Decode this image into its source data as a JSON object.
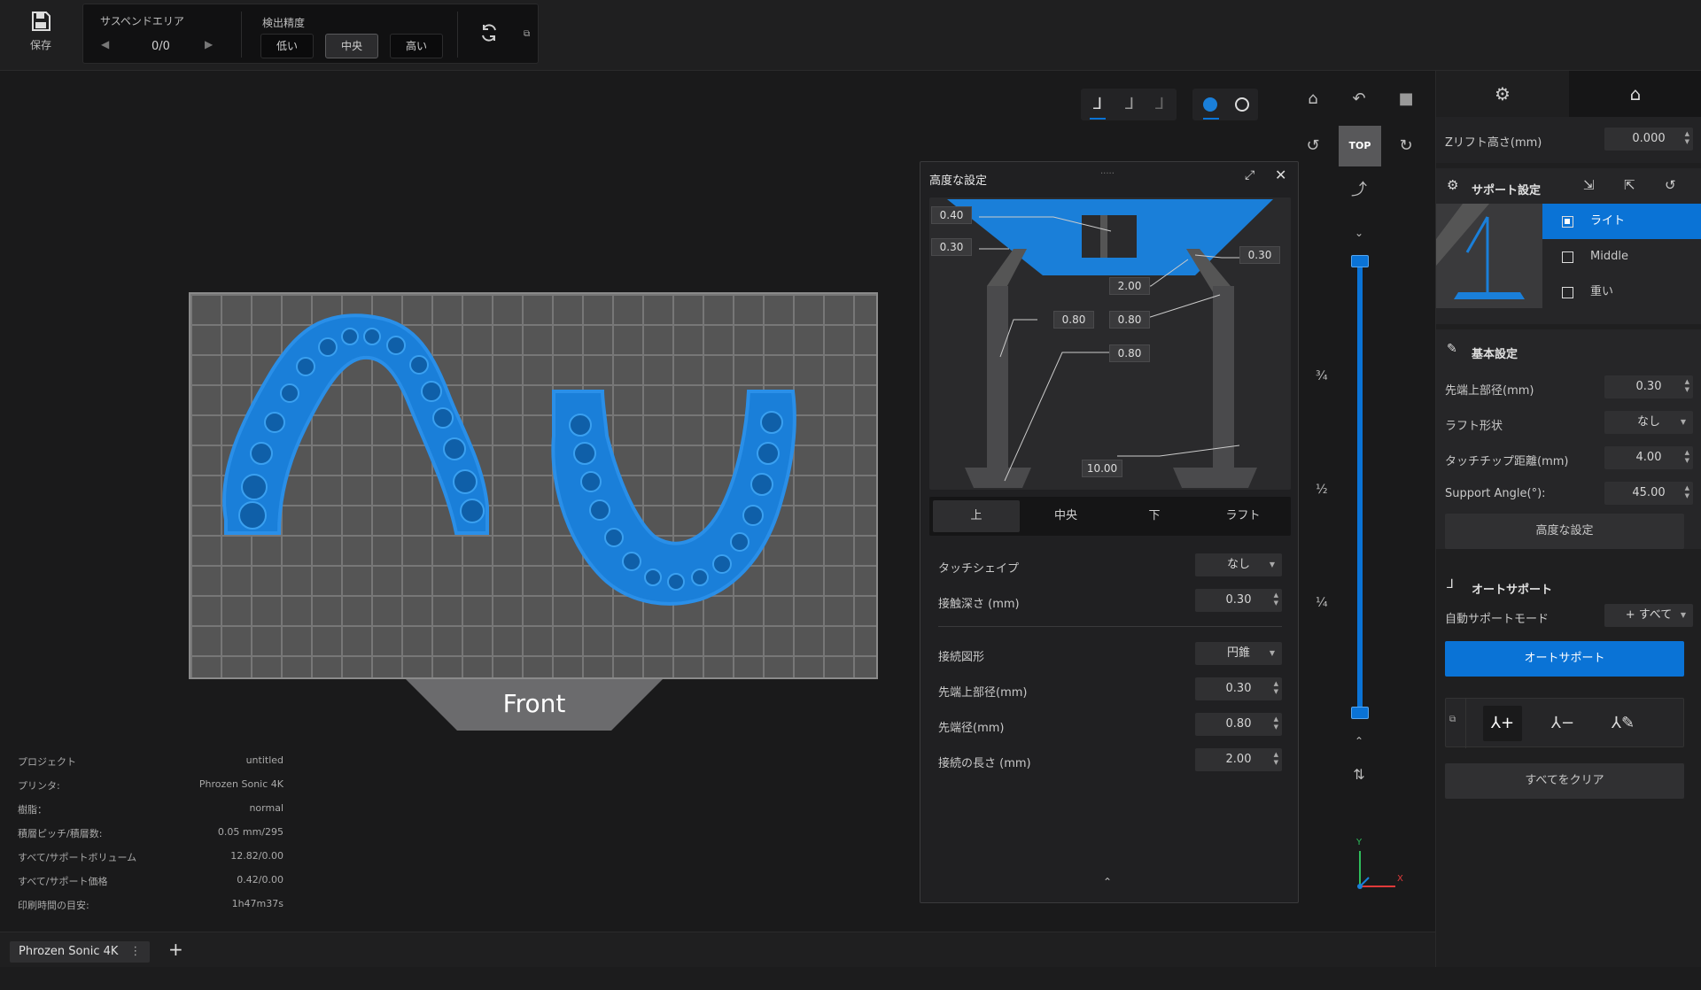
{
  "toolbar": {
    "save_label": "保存",
    "suspend_area_label": "サスペンドエリア",
    "suspend_count": "0/0",
    "detect_precision_label": "検出精度",
    "precision_options": [
      "低い",
      "中央",
      "高い"
    ],
    "precision_selected": "中央"
  },
  "viewport": {
    "front_label": "Front",
    "top_view_label": "TOP",
    "slider_marks": [
      "¾",
      "½",
      "¼"
    ],
    "axis_labels": {
      "y": "Y",
      "x": "X"
    }
  },
  "project_info": {
    "rows": [
      {
        "label": "プロジェクト",
        "value": "untitled"
      },
      {
        "label": "プリンタ:",
        "value": "Phrozen Sonic 4K"
      },
      {
        "label": "樹脂：",
        "value": "normal"
      },
      {
        "label": "積層ピッチ/積層数:",
        "value": "0.05 mm/295"
      },
      {
        "label": "すべて/サポートボリューム",
        "value": "12.82/0.00"
      },
      {
        "label": "すべて/サポート価格",
        "value": "0.42/0.00"
      },
      {
        "label": "印刷時間の目安:",
        "value": "1h47m37s"
      }
    ]
  },
  "printer_tab": {
    "label": "Phrozen Sonic 4K",
    "add_label": "+"
  },
  "advanced_panel": {
    "title": "高度な設定",
    "diagram_values": {
      "top_a": "0.40",
      "top_b": "0.30",
      "top_right": "0.30",
      "mid_2": "2.00",
      "mid_left": "0.80",
      "mid_right": "0.80",
      "mid_lower": "0.80",
      "base": "10.00"
    },
    "tabs": [
      "上",
      "中央",
      "下",
      "ラフト"
    ],
    "selected_tab": "上",
    "rows": [
      {
        "label": "タッチシェイプ",
        "value": "なし",
        "type": "dropdown"
      },
      {
        "label": "接触深さ (mm)",
        "value": "0.30",
        "type": "number"
      },
      {
        "label": "接続図形",
        "value": "円錐",
        "type": "dropdown"
      },
      {
        "label": "先端上部径(mm)",
        "value": "0.30",
        "type": "number"
      },
      {
        "label": "先端径(mm)",
        "value": "0.80",
        "type": "number"
      },
      {
        "label": "接続の長さ (mm)",
        "value": "2.00",
        "type": "number"
      }
    ]
  },
  "right_panel": {
    "z_lift_label": "Zリフト高さ(mm)",
    "z_lift_value": "0.000",
    "support_settings_title": "サポート設定",
    "support_presets": [
      "ライト",
      "Middle",
      "重い"
    ],
    "support_selected": "ライト",
    "basic_settings_title": "基本設定",
    "basic_rows": [
      {
        "label": "先端上部径(mm)",
        "value": "0.30",
        "type": "number"
      },
      {
        "label": "ラフト形状",
        "value": "なし",
        "type": "dropdown"
      },
      {
        "label": "タッチチップ距離(mm)",
        "value": "4.00",
        "type": "number"
      },
      {
        "label": "Support Angle(°):",
        "value": "45.00",
        "type": "number"
      }
    ],
    "advanced_button": "高度な設定",
    "auto_support_title": "オートサポート",
    "auto_mode_label": "自動サポートモード",
    "auto_mode_value": "+ すべて",
    "auto_support_button": "オートサポート",
    "clear_all_button": "すべてをクリア"
  },
  "colors": {
    "accent": "#0a73d6",
    "model_blue": "#1a7fd9",
    "background": "#161617"
  }
}
